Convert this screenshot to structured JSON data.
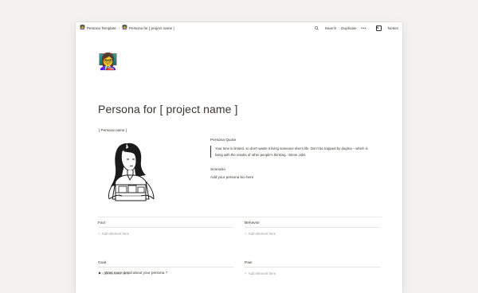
{
  "topbar": {
    "breadcrumbs": [
      {
        "icon": "👩‍🏫",
        "label": "Persona Template"
      },
      {
        "icon": "👩‍🏫",
        "label": "Persona for [ project name ]"
      }
    ],
    "separator": "/",
    "search_label": "Search",
    "duplicate_label": "Duplicate",
    "more_label": "•••",
    "notion_label": "Notion"
  },
  "page": {
    "icon": "👩‍🏫",
    "title": "Persona for [ project name ]",
    "persona_name": "[ Persona name ]",
    "quote_heading": "Persona Quote",
    "quote_text": "Your time is limited, so don't waste it living someone else's life. Don't be trapped by dogma – which is living with the results of other people's thinking. -Steve Jobs",
    "scenario_heading": "Scenario",
    "scenario_text": "Add your persona bio here"
  },
  "databases": {
    "add_label": "Add element here",
    "fact": "Fact",
    "behavior": "Behavior",
    "goal": "Goal",
    "pain": "Pain"
  },
  "toggle": {
    "label": "Want more detail about your persona ?"
  }
}
